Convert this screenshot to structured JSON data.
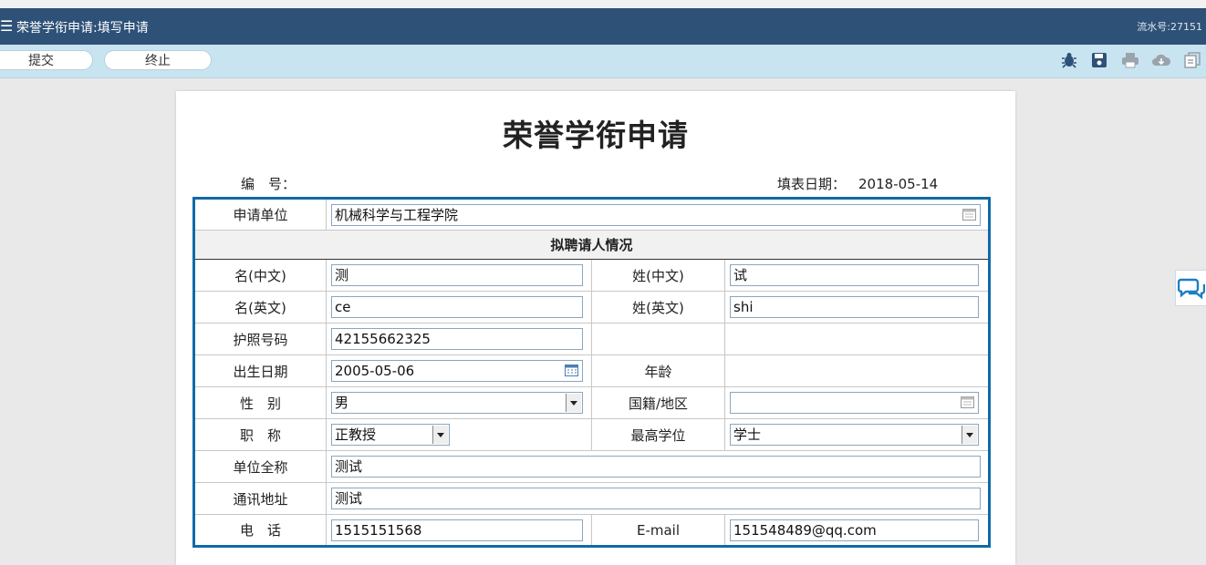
{
  "header": {
    "menu_icon": "hamburger-icon",
    "title": "荣誉学衔申请:填写申请",
    "serial_label": "流水号:27151"
  },
  "toolbar": {
    "submit_label": "提交",
    "stop_label": "终止",
    "icons": [
      "bug-icon",
      "save-icon",
      "print-icon",
      "cloud-download-icon",
      "copy-icon"
    ]
  },
  "form": {
    "title": "荣誉学衔申请",
    "number_label": "编　号：",
    "date_label": "填表日期：",
    "date_value": "2018-05-14",
    "section_title": "拟聘请人情况",
    "fields": {
      "unit": {
        "label": "申请单位",
        "value": "机械科学与工程学院"
      },
      "first_name_cn": {
        "label": "名(中文)",
        "value": "测"
      },
      "last_name_cn": {
        "label": "姓(中文)",
        "value": "试"
      },
      "first_name_en": {
        "label": "名(英文)",
        "value": "ce"
      },
      "last_name_en": {
        "label": "姓(英文)",
        "value": "shi"
      },
      "passport": {
        "label": "护照号码",
        "value": "42155662325"
      },
      "birth_date": {
        "label": "出生日期",
        "value": "2005-05-06"
      },
      "age": {
        "label": "年龄",
        "value": ""
      },
      "gender": {
        "label": "性　别",
        "value": "男"
      },
      "nationality": {
        "label": "国籍/地区",
        "value": ""
      },
      "title": {
        "label": "职　称",
        "value": "正教授"
      },
      "degree": {
        "label": "最高学位",
        "value": "学士"
      },
      "org_full": {
        "label": "单位全称",
        "value": "测试"
      },
      "address": {
        "label": "通讯地址",
        "value": "测试"
      },
      "phone": {
        "label": "电　话",
        "value": "1515151568"
      },
      "email": {
        "label": "E-mail",
        "value": "151548489@qq.com"
      }
    }
  },
  "side": {
    "chat_icon": "chat-bubbles-icon"
  }
}
